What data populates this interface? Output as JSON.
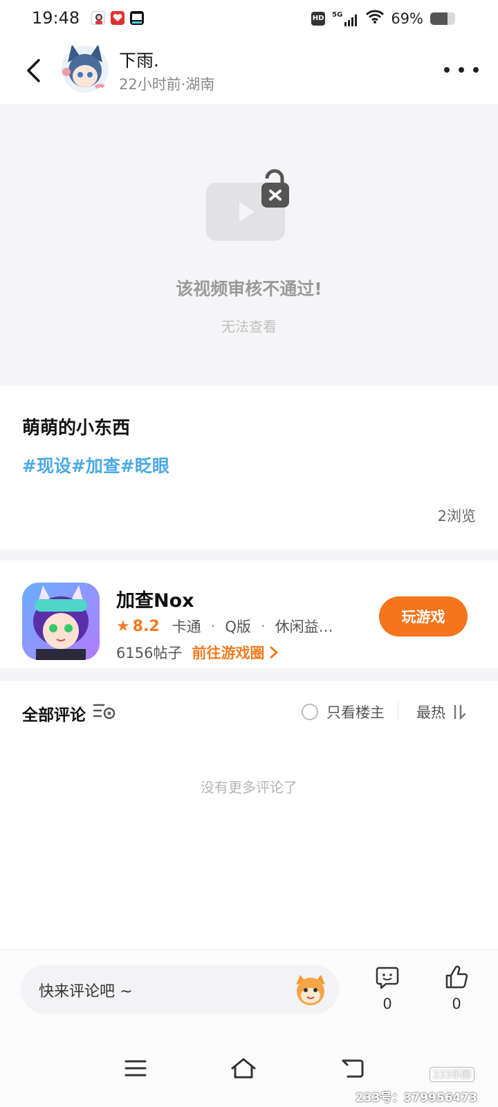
{
  "status_bar": {
    "time": "19:48",
    "signal_label": "5G",
    "hd_label": "HD",
    "battery_percent": "69%",
    "battery_level": 0.69
  },
  "header": {
    "author_name": "下雨.",
    "author_meta": "22小时前·湖南"
  },
  "video": {
    "blocked_title": "该视频审核不通过!",
    "blocked_subtitle": "无法查看"
  },
  "post": {
    "title": "萌萌的小东西",
    "tags": [
      "#现设",
      "#加查",
      "#眨眼"
    ],
    "views": "2浏览"
  },
  "game": {
    "name": "加查Nox",
    "rating": "8.2",
    "genres": [
      "卡通",
      "Q版",
      "休闲益…"
    ],
    "posts": "6156帖子",
    "goto_label": "前往游戏圈",
    "play_label": "玩游戏"
  },
  "comments": {
    "title": "全部评论",
    "only_author": "只看楼主",
    "sort_label": "最热",
    "empty_text": "没有更多评论了"
  },
  "bottom_bar": {
    "input_placeholder": "快来评论吧 ~",
    "comment_count": "0",
    "like_count": "0"
  },
  "watermark": {
    "logo": "233乐园",
    "text": "233号：379956473"
  },
  "colors": {
    "accent": "#f6741b",
    "tag": "#4ba9e8",
    "bg_gray": "#f5f5f7"
  }
}
